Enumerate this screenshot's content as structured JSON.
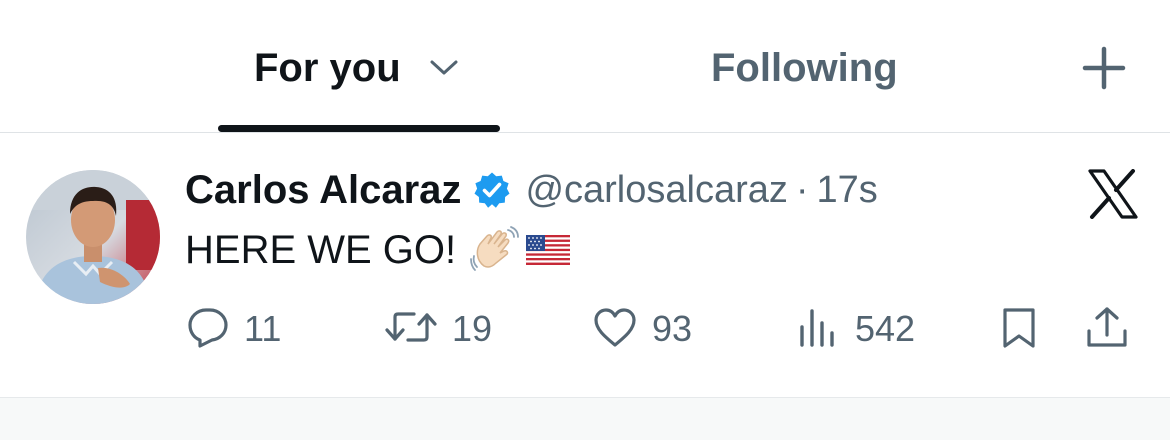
{
  "tabs": [
    {
      "label": "For you",
      "active": true
    },
    {
      "label": "Following",
      "active": false
    }
  ],
  "icons": {
    "chevron": "chevron-down-icon",
    "add": "plus-icon",
    "verified": "verified-badge-icon",
    "logo": "x-logo-icon",
    "reply": "reply-icon",
    "retweet": "retweet-icon",
    "like": "heart-icon",
    "views": "views-icon",
    "bookmark": "bookmark-icon",
    "share": "share-icon"
  },
  "tweet": {
    "author_name": "Carlos Alcaraz",
    "handle": "@carlosalcaraz",
    "separator": "·",
    "time": "17s",
    "text": "HERE WE GO!",
    "emojis": [
      "waving-hand",
      "us-flag"
    ],
    "stats": {
      "replies": "11",
      "retweets": "19",
      "likes": "93",
      "views": "542"
    }
  },
  "colors": {
    "text_primary": "#0f1419",
    "text_secondary": "#536471",
    "verified_blue": "#1d9bf0",
    "divider": "#dfe3e6"
  }
}
